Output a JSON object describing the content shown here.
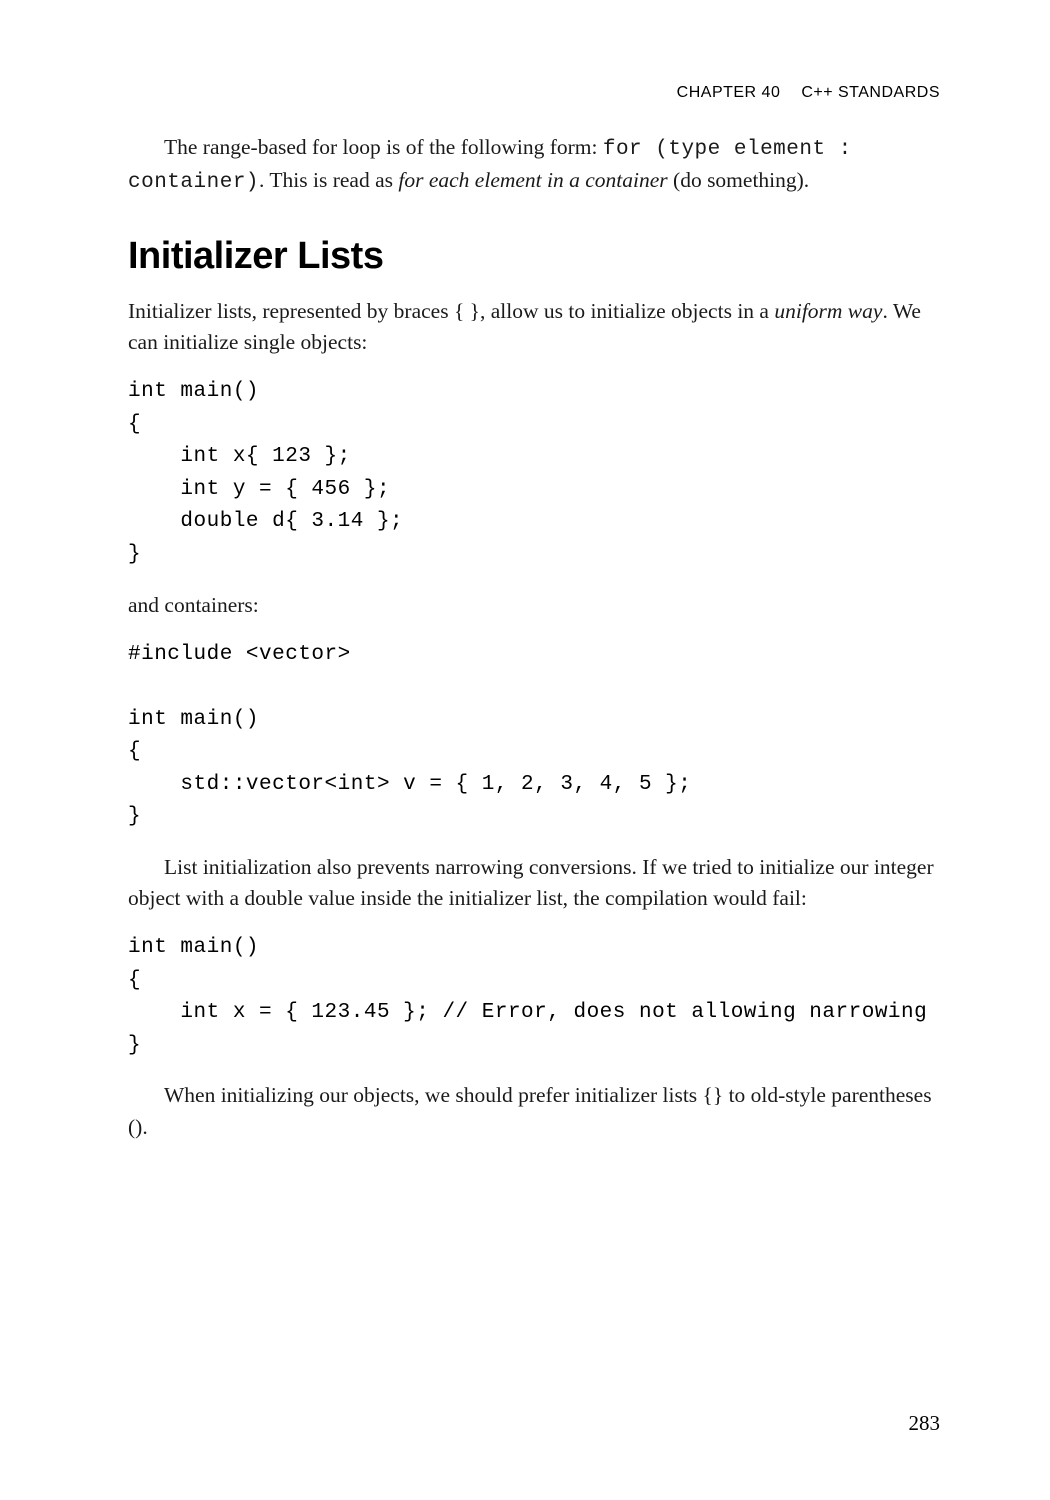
{
  "header": {
    "chapter": "CHAPTER 40",
    "title": "C++ STANDARDS"
  },
  "intro": {
    "lead": "The range-based for loop is of the following form: ",
    "code1": "for (type element : container)",
    "after1": ". This is read as ",
    "italic1": "for each element in a container",
    "after2": " (do something)."
  },
  "section": {
    "heading": "Initializer Lists",
    "p1_a": "Initializer lists, represented by braces { }, allow us to initialize objects in a ",
    "p1_italic": "uniform way",
    "p1_b": ". We can initialize single objects:"
  },
  "code1": "int main()\n{\n    int x{ 123 };\n    int y = { 456 };\n    double d{ 3.14 };\n}",
  "mid1": "and containers:",
  "code2": "#include <vector>\n\nint main()\n{\n    std::vector<int> v = { 1, 2, 3, 4, 5 };\n}",
  "para2": "List initialization also prevents narrowing conversions. If we tried to initialize our integer object with a double value inside the initializer list, the compilation would fail:",
  "code3": "int main()\n{\n    int x = { 123.45 }; // Error, does not allowing narrowing\n}",
  "para3": "When initializing our objects, we should prefer initializer lists {} to old-style parentheses ().",
  "page_number": "283"
}
